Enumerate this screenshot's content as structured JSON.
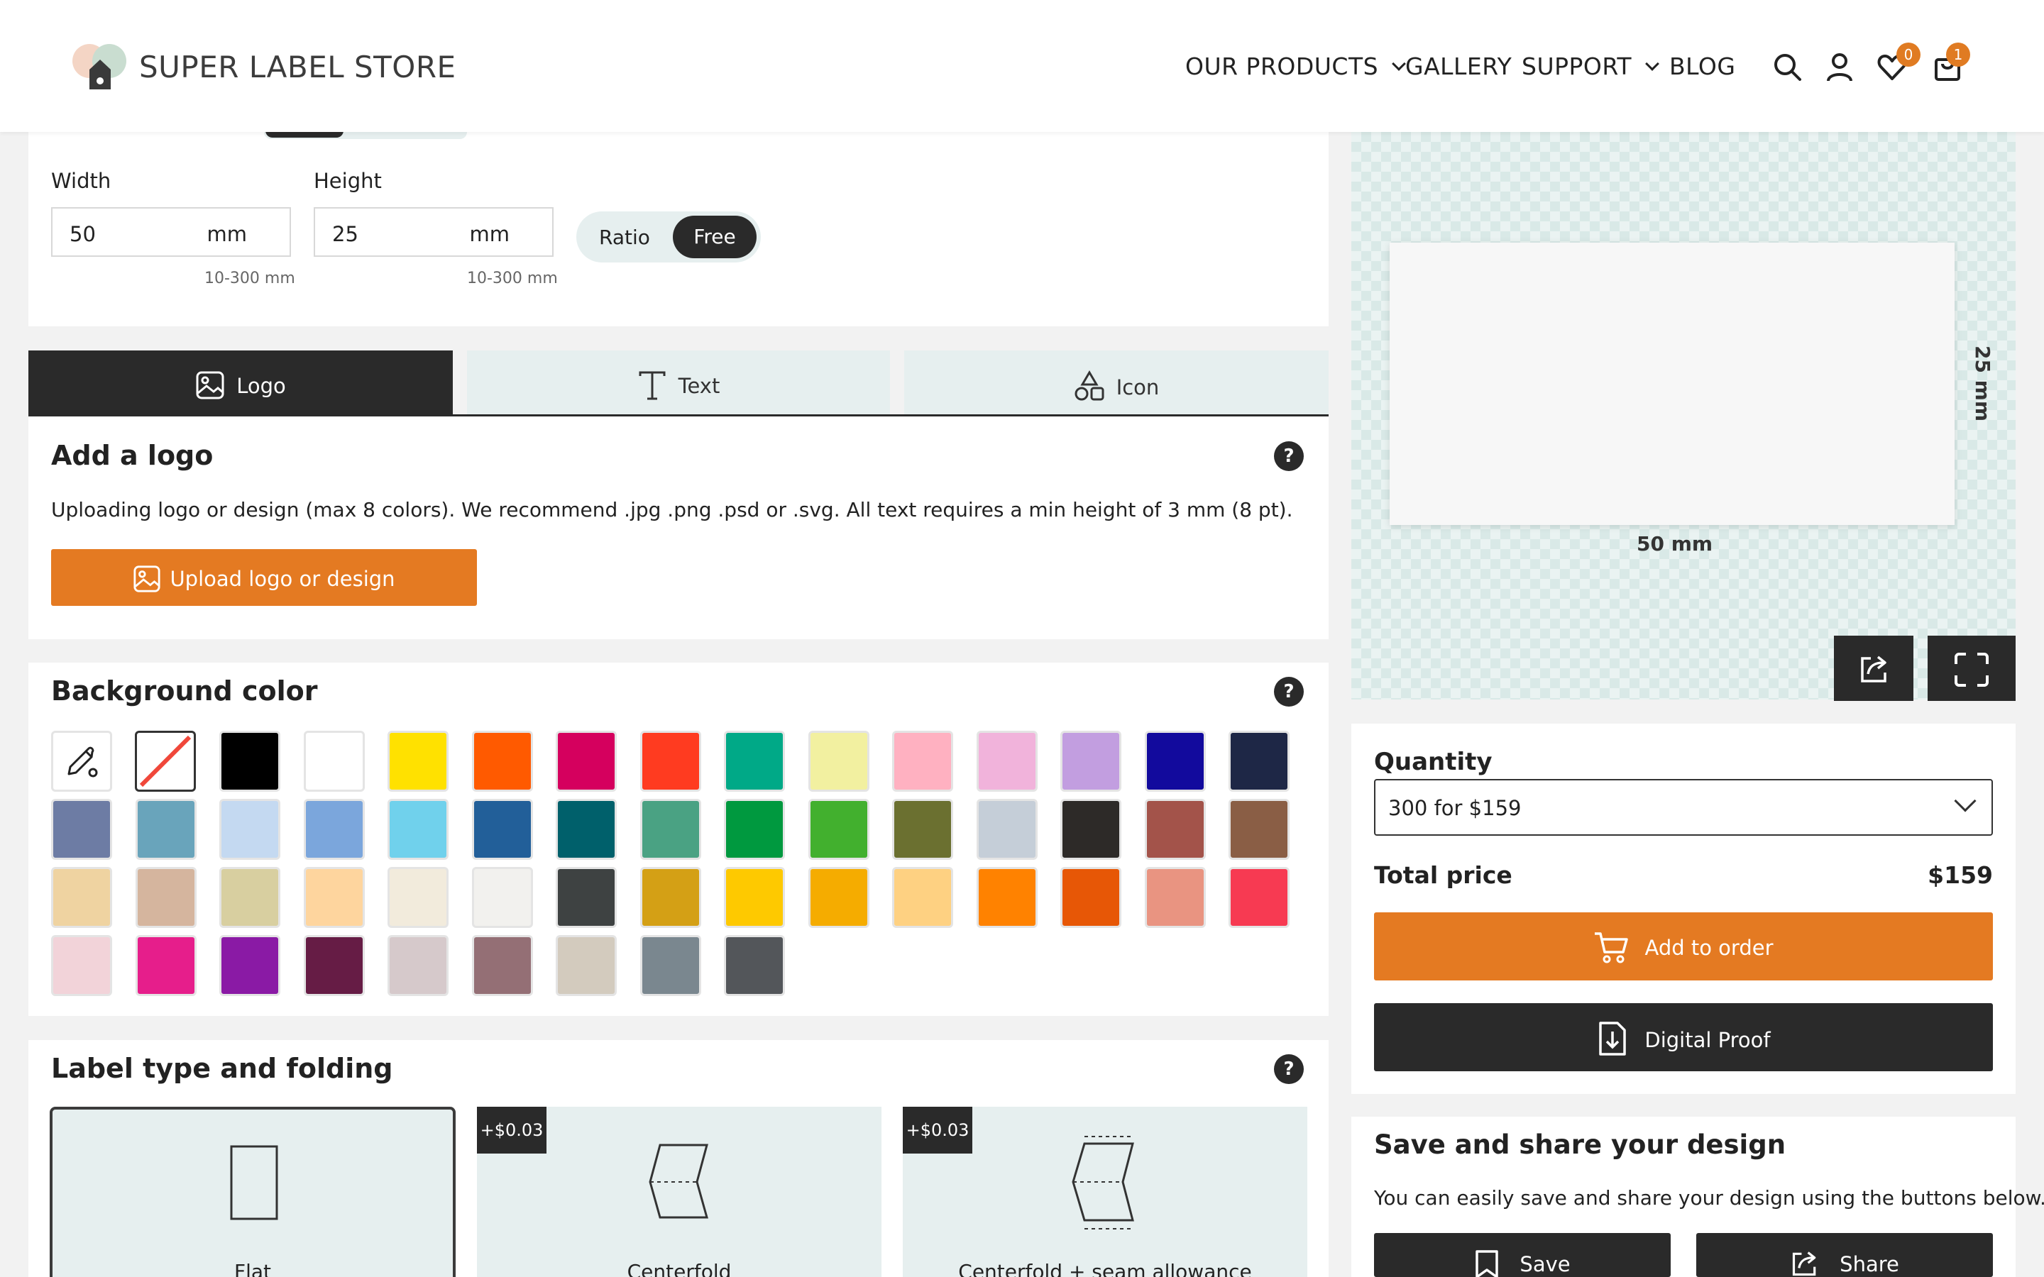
{
  "header": {
    "brand": "SUPER LABEL STORE",
    "nav": [
      "OUR PRODUCTS",
      "GALLERY",
      "SUPPORT",
      "BLOG"
    ],
    "wishlist_count": "0",
    "cart_count": "1"
  },
  "size": {
    "width_label": "Width",
    "width_value": "50",
    "width_unit": "mm",
    "width_hint": "10-300 mm",
    "height_label": "Height",
    "height_value": "25",
    "height_unit": "mm",
    "height_hint": "10-300 mm",
    "ratio_label": "Ratio",
    "free_label": "Free"
  },
  "tabs": [
    {
      "label": "Logo",
      "icon": "image-icon",
      "active": true
    },
    {
      "label": "Text",
      "icon": "text-icon",
      "active": false
    },
    {
      "label": "Icon",
      "icon": "shapes-icon",
      "active": false
    }
  ],
  "logo_section": {
    "title": "Add a logo",
    "description": "Uploading logo or design (max 8 colors). We recommend .jpg .png .psd or .svg. All text requires a min height of 3 mm (8 pt).",
    "upload_label": "Upload logo or design"
  },
  "background_color": {
    "title": "Background color",
    "swatches": [
      "#000000",
      "#ffffff",
      "#ffe100",
      "#ff5a00",
      "#d5005e",
      "#ff3b20",
      "#00a987",
      "#f2f0a0",
      "#ffb1c1",
      "#f1b3db",
      "#c29ee0",
      "#120a9d",
      "#1e2746",
      "#6d7ca4",
      "#69a4bb",
      "#c4d9f1",
      "#7ba6dc",
      "#70d1ec",
      "#225f99",
      "#00606b",
      "#4aa283",
      "#00993f",
      "#42b02e",
      "#6b7030",
      "#c5ced8",
      "#2d2a28",
      "#a3534a",
      "#8a5e45",
      "#efd3a1",
      "#d5b59e",
      "#d8cfa0",
      "#fed59e",
      "#f2ebdc",
      "#f2f1ee",
      "#3e4242",
      "#d4a015",
      "#fec900",
      "#f5ac00",
      "#fed182",
      "#ff8200",
      "#e75706",
      "#e99481",
      "#f73a52",
      "#f2d3d9",
      "#e61e8b",
      "#8a1aa5",
      "#661c45",
      "#d6c9cb",
      "#946f75",
      "#d3cbbe",
      "#7a878f",
      "#53565a"
    ]
  },
  "folding": {
    "title": "Label type and folding",
    "options": [
      {
        "label": "Flat",
        "price": ""
      },
      {
        "label": "Centerfold",
        "price": "+$0.03"
      },
      {
        "label": "Centerfold + seam allowance",
        "price": "+$0.03"
      }
    ]
  },
  "preview": {
    "width_dim": "50 mm",
    "height_dim": "25 mm"
  },
  "order": {
    "quantity_label": "Quantity",
    "quantity_value": "300 for $159",
    "total_label": "Total price",
    "total_value": "$159",
    "add_label": "Add to order",
    "proof_label": "Digital Proof"
  },
  "share": {
    "title": "Save and share your design",
    "description": "You can easily save and share your design using the buttons below.",
    "save_label": "Save",
    "share_label": "Share"
  },
  "colors": {
    "accent": "#e47a22",
    "dark": "#2a2a2a",
    "tab_bg": "#e6efef"
  }
}
